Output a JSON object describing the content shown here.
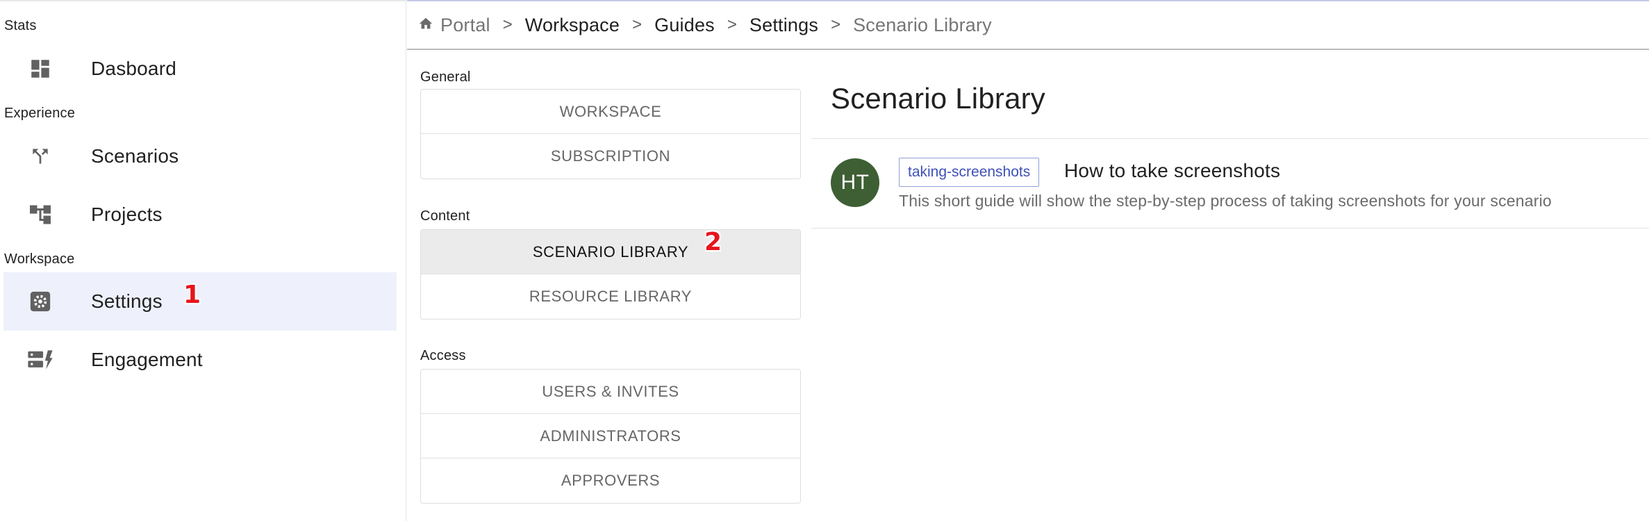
{
  "sidebar": {
    "sections": [
      {
        "label": "Stats"
      },
      {
        "label": "Experience"
      },
      {
        "label": "Workspace"
      }
    ],
    "items": [
      {
        "label": "Dasboard",
        "icon": "dashboard-icon"
      },
      {
        "label": "Scenarios",
        "icon": "fork-icon"
      },
      {
        "label": "Projects",
        "icon": "hierarchy-icon"
      },
      {
        "label": "Settings",
        "icon": "gear-icon",
        "active": true
      },
      {
        "label": "Engagement",
        "icon": "engagement-icon"
      }
    ]
  },
  "markers": {
    "one": "1",
    "two": "2"
  },
  "breadcrumb": {
    "items": [
      "Portal",
      "Workspace",
      "Guides",
      "Settings",
      "Scenario Library"
    ],
    "separator": ">"
  },
  "settings_menu": {
    "groups": [
      {
        "title": "General",
        "items": [
          "WORKSPACE",
          "SUBSCRIPTION"
        ]
      },
      {
        "title": "Content",
        "items": [
          "SCENARIO LIBRARY",
          "RESOURCE LIBRARY"
        ],
        "selected": "SCENARIO LIBRARY"
      },
      {
        "title": "Access",
        "items": [
          "USERS & INVITES",
          "ADMINISTRATORS",
          "APPROVERS"
        ]
      }
    ]
  },
  "main": {
    "title": "Scenario Library",
    "guides": [
      {
        "initials": "HT",
        "tag": "taking-screenshots",
        "title": "How to take screenshots",
        "description": "This short guide will show the step-by-step process of taking screenshots for your scenario"
      }
    ]
  },
  "colors": {
    "active_nav_bg": "#eef1fb",
    "avatar_bg": "#3e5f34",
    "tag_text": "#3f51b5",
    "marker": "#e8141c"
  }
}
